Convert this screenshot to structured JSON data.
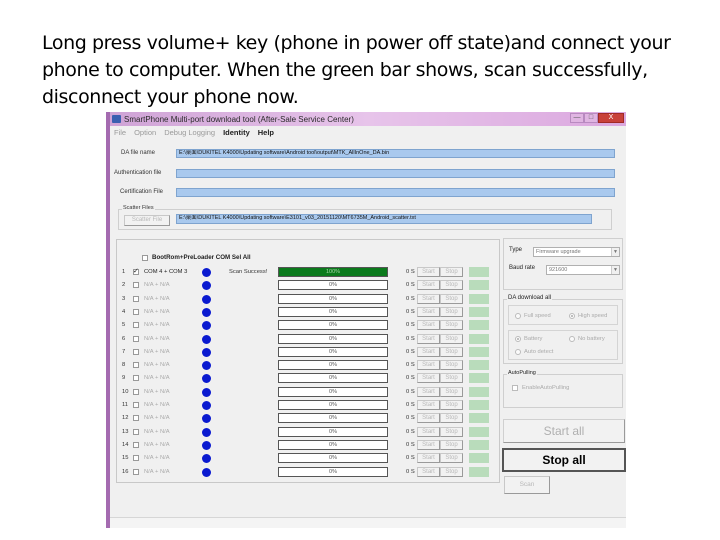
{
  "caption": "Long press volume+ key (phone in power off state)and connect your phone to computer. When the green bar shows, scan successfully, disconnect your phone now.",
  "window": {
    "title": "SmartPhone Multi-port download tool (After-Sale Service Center)",
    "controls": {
      "minimize": "—",
      "maximize": "□",
      "close": "X"
    }
  },
  "menu": [
    "File",
    "Option",
    "Debug Logging",
    "Identity",
    "Help"
  ],
  "files": {
    "da_label": "DA file name",
    "da_value": "E:\\桌面\\DUKITEL K4000\\Updating software\\Android tool\\output\\MTK_AllInOne_DA.bin",
    "auth_label": "Authentication file",
    "auth_value": "",
    "cert_label": "Certification File",
    "cert_value": "",
    "scatter_group": "Scatter Files",
    "scatter_button": "Scatter File",
    "scatter_value": "E:\\桌面\\DUKITEL K4000\\Updating software\\E3101_v03_20151120\\MT6735M_Android_scatter.txt"
  },
  "ports": {
    "select_all_label": "BootRom+PreLoader COM Sel All",
    "start_label": "Start",
    "stop_label": "Stop",
    "rows": [
      {
        "num": "1",
        "checked": true,
        "com": "COM 4 + COM 3",
        "status": "Scan Success!",
        "progress": 100,
        "progress_text": "100%",
        "time": "0 S"
      },
      {
        "num": "2",
        "checked": false,
        "com": "N/A + N/A",
        "status": "",
        "progress": 0,
        "progress_text": "0%",
        "time": "0 S"
      },
      {
        "num": "3",
        "checked": false,
        "com": "N/A + N/A",
        "status": "",
        "progress": 0,
        "progress_text": "0%",
        "time": "0 S"
      },
      {
        "num": "4",
        "checked": false,
        "com": "N/A + N/A",
        "status": "",
        "progress": 0,
        "progress_text": "0%",
        "time": "0 S"
      },
      {
        "num": "5",
        "checked": false,
        "com": "N/A + N/A",
        "status": "",
        "progress": 0,
        "progress_text": "0%",
        "time": "0 S"
      },
      {
        "num": "6",
        "checked": false,
        "com": "N/A + N/A",
        "status": "",
        "progress": 0,
        "progress_text": "0%",
        "time": "0 S"
      },
      {
        "num": "7",
        "checked": false,
        "com": "N/A + N/A",
        "status": "",
        "progress": 0,
        "progress_text": "0%",
        "time": "0 S"
      },
      {
        "num": "8",
        "checked": false,
        "com": "N/A + N/A",
        "status": "",
        "progress": 0,
        "progress_text": "0%",
        "time": "0 S"
      },
      {
        "num": "9",
        "checked": false,
        "com": "N/A + N/A",
        "status": "",
        "progress": 0,
        "progress_text": "0%",
        "time": "0 S"
      },
      {
        "num": "10",
        "checked": false,
        "com": "N/A + N/A",
        "status": "",
        "progress": 0,
        "progress_text": "0%",
        "time": "0 S"
      },
      {
        "num": "11",
        "checked": false,
        "com": "N/A + N/A",
        "status": "",
        "progress": 0,
        "progress_text": "0%",
        "time": "0 S"
      },
      {
        "num": "12",
        "checked": false,
        "com": "N/A + N/A",
        "status": "",
        "progress": 0,
        "progress_text": "0%",
        "time": "0 S"
      },
      {
        "num": "13",
        "checked": false,
        "com": "N/A + N/A",
        "status": "",
        "progress": 0,
        "progress_text": "0%",
        "time": "0 S"
      },
      {
        "num": "14",
        "checked": false,
        "com": "N/A + N/A",
        "status": "",
        "progress": 0,
        "progress_text": "0%",
        "time": "0 S"
      },
      {
        "num": "15",
        "checked": false,
        "com": "N/A + N/A",
        "status": "",
        "progress": 0,
        "progress_text": "0%",
        "time": "0 S"
      },
      {
        "num": "16",
        "checked": false,
        "com": "N/A + N/A",
        "status": "",
        "progress": 0,
        "progress_text": "0%",
        "time": "0 S"
      }
    ]
  },
  "settings": {
    "type_label": "Type",
    "type_value": "Firmware upgrade",
    "baud_label": "Baud rate",
    "baud_value": "921600",
    "da_download_group": "DA download all",
    "full_speed": "Full speed",
    "high_speed": "High speed",
    "speed_selected": "High speed",
    "battery": "Battery",
    "no_battery": "No battery",
    "auto_detect": "Auto detect",
    "battery_selected": "Battery",
    "autopulling_group": "AutoPulling",
    "enable_autopulling": "EnableAutoPulling",
    "enable_autopulling_checked": false
  },
  "actions": {
    "start_all": "Start all",
    "stop_all": "Stop all",
    "scan": "Scan"
  },
  "colors": {
    "progress_done": "#0b7a1c",
    "status_dot": "#0a1ad0",
    "field_bg": "#a9c9ee",
    "title_bar": "#e7c4ea"
  }
}
